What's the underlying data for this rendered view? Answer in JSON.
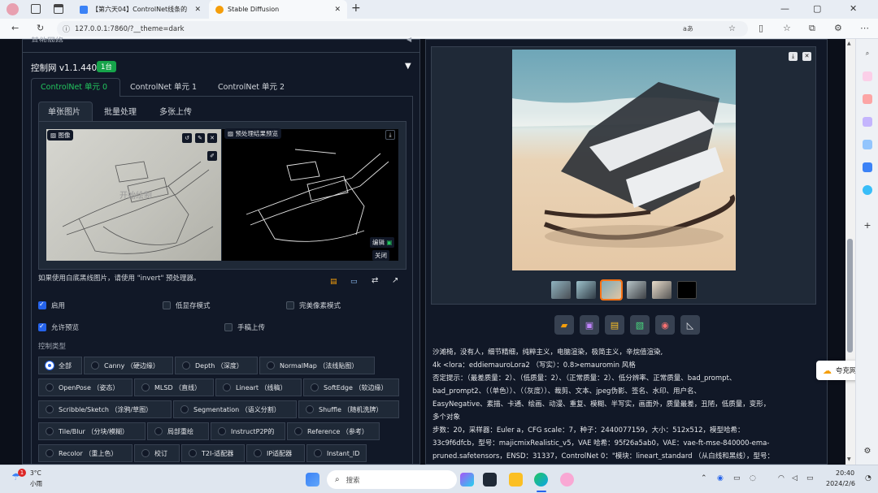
{
  "browser": {
    "tabs": [
      {
        "title": "【第六天04】ControlNet线条的"
      },
      {
        "title": "Stable Diffusion"
      }
    ],
    "url": "127.0.0.1:7860/?__theme=dark",
    "reader_label": "aあ"
  },
  "left": {
    "cut_header": "其他网络",
    "controlnet_title": "控制网 v1.1.440",
    "units_badge": "1台",
    "collapse_glyph": "▼",
    "unit_tabs": [
      "ControlNet 单元 0",
      "ControlNet 单元 1",
      "ControlNet 单元 2"
    ],
    "image_tabs": [
      "单张图片",
      "批量处理",
      "多张上传"
    ],
    "image_label": "图像",
    "preview_label": "预处理结果预览",
    "edit_label": "编辑",
    "close_label": "关闭",
    "sketch_watermark": "开始绘制",
    "hint": "如果使用白底黑线图片，请使用 \"invert\" 预处理器。",
    "checkboxes": {
      "enable": "启用",
      "low_vram": "低显存模式",
      "pixel_perfect": "完美像素模式",
      "allow_preview": "允许预览",
      "upload_sketch": "手稿上传"
    },
    "control_type_label": "控制类型",
    "control_types": [
      "全部",
      "Canny （硬边缘）",
      "Depth （深度）",
      "NormalMap （法线贴图）",
      "OpenPose （姿态）",
      "MLSD （直线）",
      "Lineart （线稿）",
      "SoftEdge （软边缘）",
      "Scribble/Sketch （涂鸦/草图）",
      "Segmentation （语义分割）",
      "Shuffle （随机洗牌）",
      "Tile/Blur （分块/模糊）",
      "局部重绘",
      "InstructP2P的",
      "Reference （参考）",
      "Recolor （重上色）",
      "校订",
      "T2I-适配器",
      "IP适配器",
      "Instant_ID"
    ]
  },
  "right": {
    "lines": [
      "沙滩椅，没有人，细节精细，纯粹主义，电脑渲染，极简主义，辛烷值渲染,",
      "4k <lora：eddiemauroLora2 （写实）：0.8>emauromin 风格",
      "否定提示：（最差质量：2）、（低质量：2）、（正常质量：2）、低分辨率、正常质量、bad_prompt、",
      "bad_prompt2、（（单色））、（（灰度））、裁剪、文本、jpeg伪影、签名、水印、用户名、",
      "EasyNegative、素描、卡通、绘画、动漫、重复、模糊、半写实，画面外，质量最差，丑陋，低质量，变形，",
      "多个对象",
      "步数：20，采样器：Euler a，CFG scale：7，种子：2440077159，大小：512x512，模型哈希：",
      "33c9f6dfcb，型号：majicmixRealistic_v5，VAE 哈希：95f26a5ab0，VAE：vae-ft-mse-840000-ema-",
      "pruned.safetensors，ENSD：31337，ControlNet 0：\"模块：lineart_standard （从白线和黑线），型号："
    ]
  },
  "taskbar": {
    "weather_temp": "3°C",
    "weather_desc": "小雨",
    "search_placeholder": "搜索",
    "time": "20:40",
    "date": "2024/2/6",
    "notification_count": "1",
    "popup": "夸克网盘"
  }
}
